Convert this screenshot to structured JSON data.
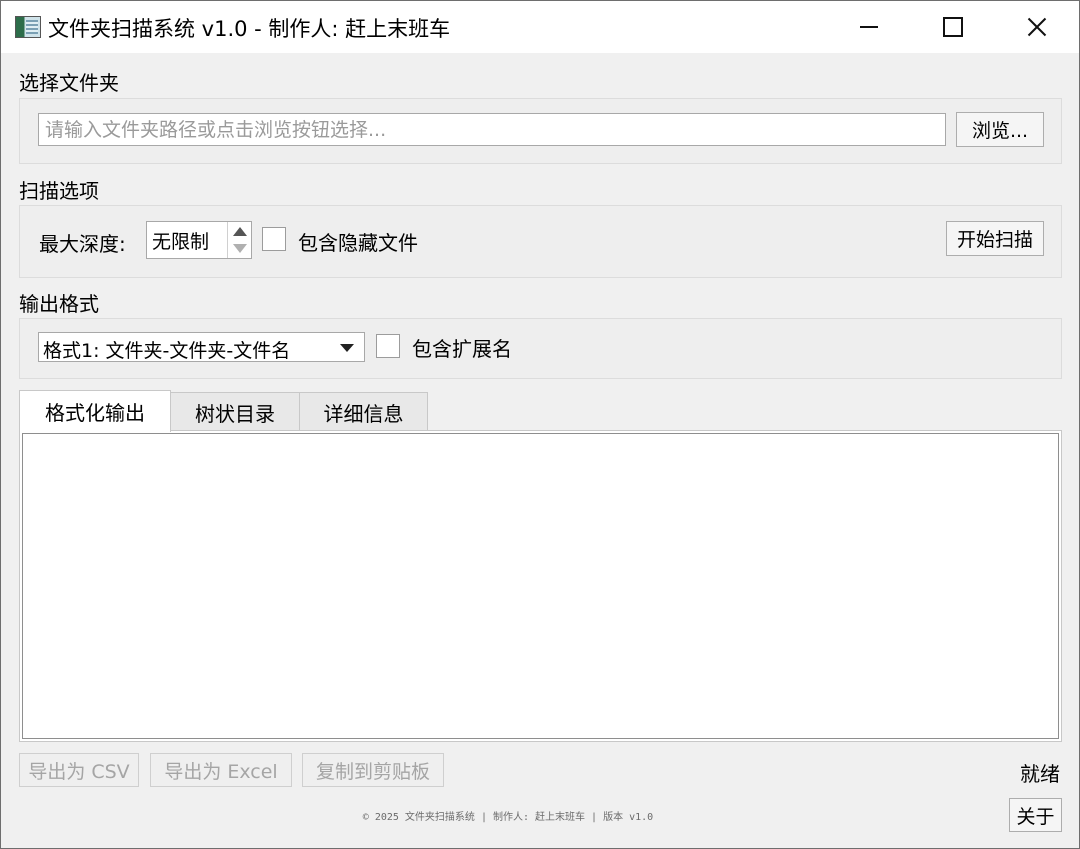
{
  "window": {
    "title": "文件夹扫描系统 v1.0 - 制作人: 赶上末班车"
  },
  "folder_section": {
    "label": "选择文件夹",
    "path_placeholder": "请输入文件夹路径或点击浏览按钮选择...",
    "browse_label": "浏览..."
  },
  "scan_section": {
    "label": "扫描选项",
    "max_depth_label": "最大深度:",
    "max_depth_value": "无限制",
    "include_hidden_label": "包含隐藏文件",
    "include_hidden_checked": false,
    "start_scan_label": "开始扫描"
  },
  "output_section": {
    "label": "输出格式",
    "format_selected": "格式1: 文件夹-文件夹-文件名",
    "include_ext_label": "包含扩展名",
    "include_ext_checked": false
  },
  "tabs": [
    {
      "label": "格式化输出",
      "active": true
    },
    {
      "label": "树状目录",
      "active": false
    },
    {
      "label": "详细信息",
      "active": false
    }
  ],
  "actions": {
    "export_csv": "导出为 CSV",
    "export_excel": "导出为 Excel",
    "copy_clipboard": "复制到剪贴板"
  },
  "status": "就绪",
  "footer": "© 2025 文件夹扫描系统 | 制作人: 赶上末班车 | 版本 v1.0",
  "about_label": "关于"
}
